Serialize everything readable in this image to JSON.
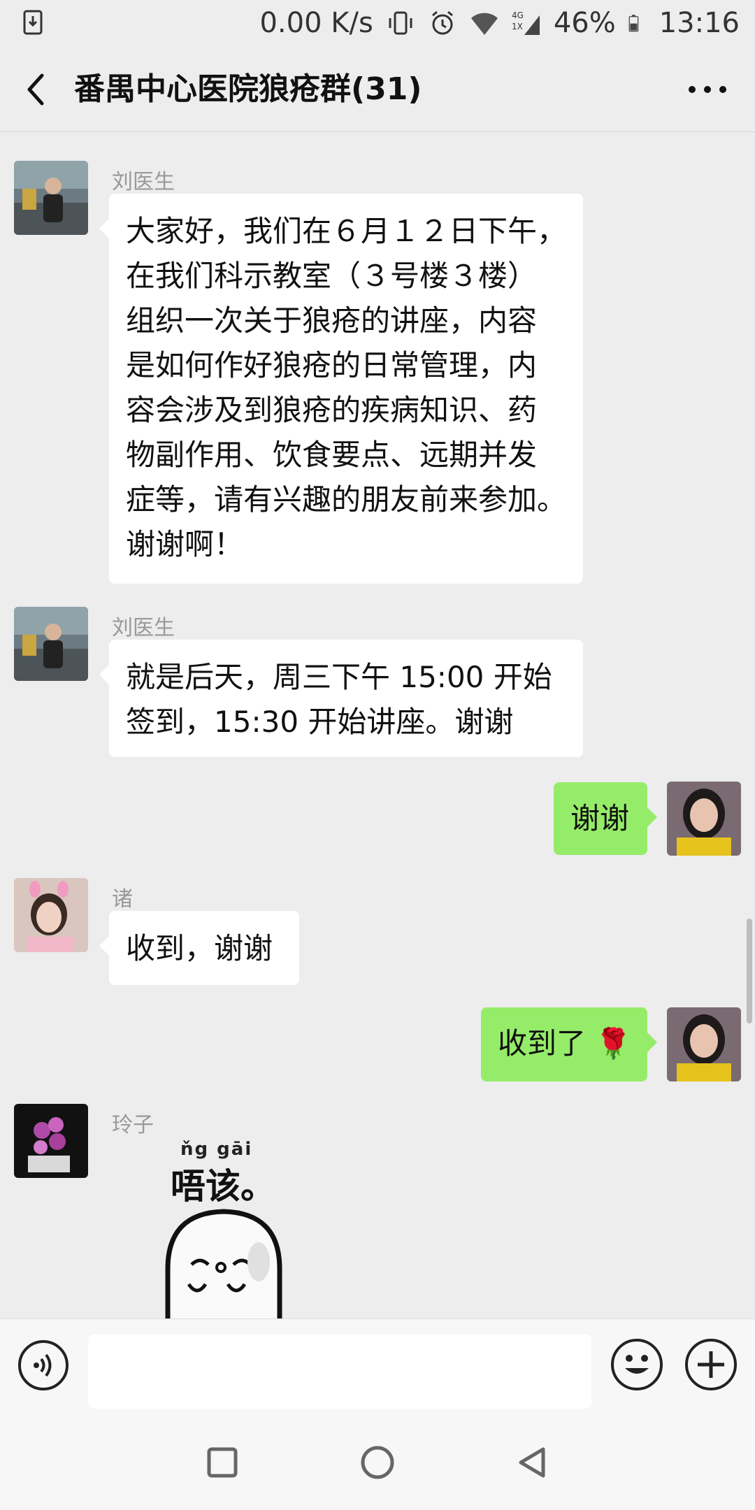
{
  "status_bar": {
    "speed": "0.00 K/s",
    "network": "4G 1X",
    "battery": "46%",
    "time": "13:16"
  },
  "header": {
    "title": "番禺中心医院狼疮群(31)",
    "back_icon": "chevron-left-icon",
    "more_icon": "more-dots-icon"
  },
  "messages": [
    {
      "sender": "刘医生",
      "side": "left",
      "lines": [
        "大家好，我们在６月１２日下午，",
        "在我们科示教室（３号楼３楼）",
        "组织一次关于狼疮的讲座，内容",
        "是如何作好狼疮的日常管理，内",
        "容会涉及到狼疮的疾病知识、药",
        "物副作用、饮食要点、远期并发",
        "症等，请有兴趣的朋友前来参加。",
        "谢谢啊！"
      ]
    },
    {
      "sender": "刘医生",
      "side": "left",
      "lines": [
        "就是后天，周三下午 15:00 开始",
        "签到，15:30 开始讲座。谢谢"
      ]
    },
    {
      "sender": "",
      "side": "right",
      "lines": [
        "谢谢"
      ]
    },
    {
      "sender": "诸",
      "side": "left",
      "lines": [
        "收到，谢谢"
      ]
    },
    {
      "sender": "",
      "side": "right",
      "lines": [
        "收到了 🌹"
      ]
    },
    {
      "sender": "玲子",
      "side": "left",
      "sticker": {
        "pinyin": "ňg gāi",
        "text": "唔该。"
      }
    }
  ],
  "input_bar": {
    "placeholder": "",
    "voice_icon": "voice-icon",
    "emoji_icon": "emoji-icon",
    "plus_icon": "plus-icon"
  },
  "nav_bar": {
    "recents_icon": "square-icon",
    "home_icon": "circle-icon",
    "back_icon": "triangle-back-icon"
  },
  "colors": {
    "background": "#ededed",
    "my_bubble": "#95ec69",
    "other_bubble": "#ffffff",
    "name_text": "#999999"
  }
}
